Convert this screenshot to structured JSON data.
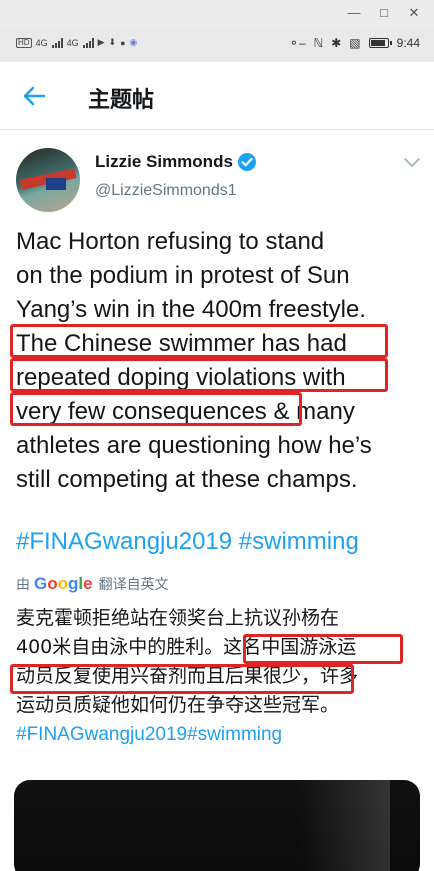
{
  "status_bar": {
    "time": "9:44",
    "sim1": "HD",
    "sim2": "HD",
    "net1": "4G",
    "net2": "4G"
  },
  "appbar": {
    "title": "主题帖"
  },
  "tweet": {
    "author_name": "Lizzie Simmonds",
    "author_handle": "@LizzieSimmonds1",
    "body_lines": [
      "Mac Horton refusing to stand",
      "on the podium in protest of Sun",
      "Yang’s win in the 400m freestyle.",
      "The Chinese swimmer has had",
      "repeated doping violations with",
      "very few consequences & many",
      "athletes are questioning how he’s",
      "still competing at these champs."
    ],
    "hashtags": "#FINAGwangju2019 #swimming",
    "translate_prefix": "由",
    "translate_brand": "Google",
    "translate_suffix": "翻译自英文",
    "translation_lines": [
      "麦克霍顿拒绝站在领奖台上抗议孙杨在",
      "400米自由泳中的胜利。这名中国游泳运",
      "动员反复使用兴奋剂而且后果很少，许多",
      "运动员质疑他如何仍在争夺这些冠军。"
    ],
    "translation_hashtags": "#FINAGwangju2019#swimming"
  },
  "colors": {
    "link": "#1da1f2",
    "verified": "#1da1f2",
    "highlight": "#e02424",
    "secondary_text": "#657786"
  }
}
